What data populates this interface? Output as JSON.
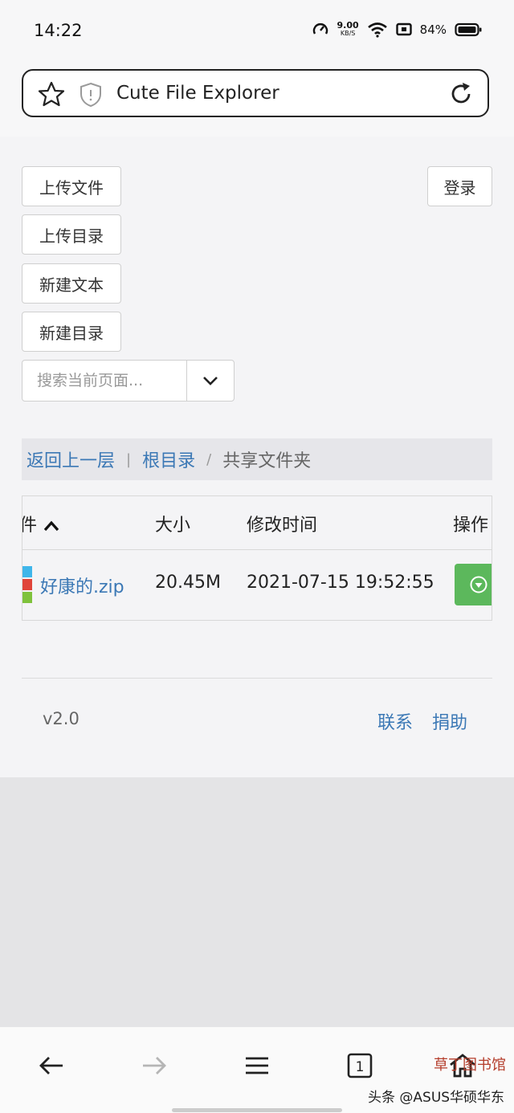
{
  "status_bar": {
    "time": "14:22",
    "net_speed_value": "9.00",
    "net_speed_unit": "KB/S",
    "battery_percent": "84%"
  },
  "url_bar": {
    "title": "Cute File Explorer",
    "star_icon": "star-icon",
    "shield_icon": "shield-icon",
    "reload_icon": "reload-icon"
  },
  "toolbar": {
    "upload_file": "上传文件",
    "upload_dir": "上传目录",
    "new_text": "新建文本",
    "new_dir": "新建目录",
    "login": "登录",
    "search_placeholder": "搜索当前页面..."
  },
  "breadcrumb": {
    "back": "返回上一层",
    "sep1": "|",
    "root": "根目录",
    "sep2": "/",
    "current": "共享文件夹"
  },
  "table": {
    "headers": {
      "name": "件",
      "size": "大小",
      "modified": "修改时间",
      "actions": "操作"
    },
    "rows": [
      {
        "name": "好康的.zip",
        "size": "20.45M",
        "modified": "2021-07-15 19:52:55"
      }
    ]
  },
  "footer": {
    "version": "v2.0",
    "contact": "联系",
    "donate": "捐助"
  },
  "watermark": {
    "text": "头条 @ASUS华硕华东",
    "mark": "草丁图书馆"
  },
  "colors": {
    "link": "#3b78b5",
    "download_button": "#5cb85c",
    "breadcrumb_bg": "#e6e6ea"
  }
}
